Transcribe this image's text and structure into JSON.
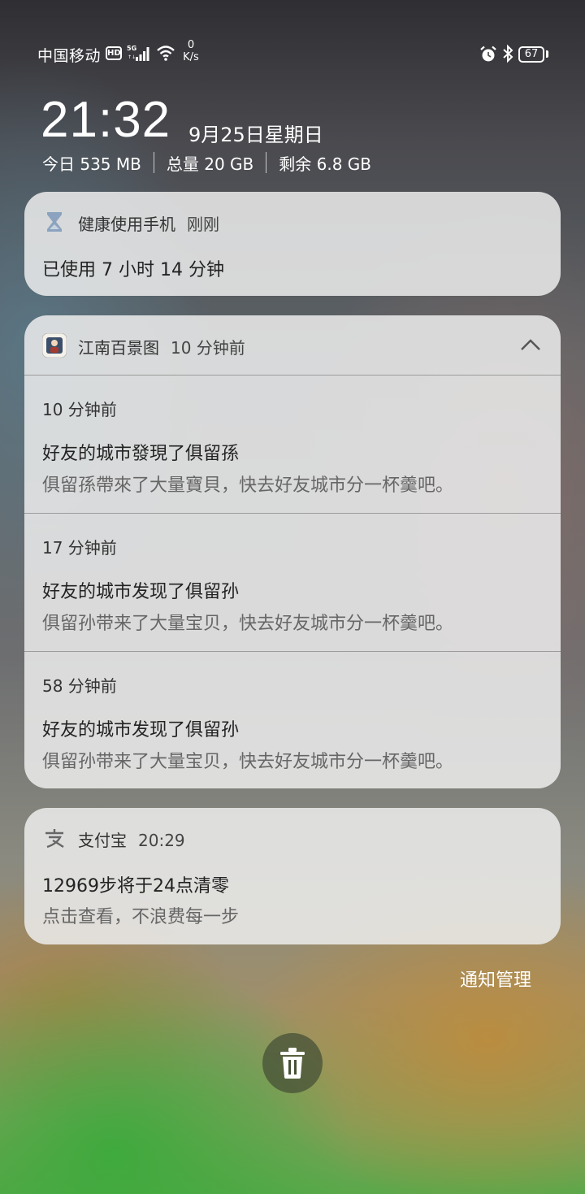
{
  "status_bar": {
    "carrier": "中国移动",
    "hd": "HD",
    "net_speed_value": "0",
    "net_speed_unit": "K/s",
    "battery": "67",
    "icons": [
      "signal-5g-icon",
      "wifi-icon",
      "alarm-icon",
      "bluetooth-icon",
      "battery-icon"
    ]
  },
  "lockscreen": {
    "time": "21:32",
    "date": "9月25日星期日",
    "memory": {
      "today": "今日 535 MB",
      "total": "总量 20 GB",
      "remaining": "剩余 6.8 GB"
    }
  },
  "notifications": [
    {
      "app": "健康使用手机",
      "time": "刚刚",
      "icon": "hourglass-icon",
      "title": "已使用 7 小时 14 分钟"
    },
    {
      "app": "江南百景图",
      "time": "10 分钟前",
      "icon": "game-app-icon",
      "expanded": true,
      "items": [
        {
          "time": "10 分钟前",
          "title": "好友的城市發現了俱留孫",
          "body": "俱留孫帶來了大量寶貝，快去好友城市分一杯羹吧。"
        },
        {
          "time": "17 分钟前",
          "title": "好友的城市发现了俱留孙",
          "body": "俱留孙带来了大量宝贝，快去好友城市分一杯羹吧。"
        },
        {
          "time": "58 分钟前",
          "title": "好友的城市发现了俱留孙",
          "body": "俱留孙带来了大量宝贝，快去好友城市分一杯羹吧。"
        }
      ]
    },
    {
      "app": "支付宝",
      "time": "20:29",
      "icon": "alipay-icon",
      "title": "12969步将于24点清零",
      "body": "点击查看，不浪费每一步"
    }
  ],
  "actions": {
    "manage_label": "通知管理",
    "clear_icon": "trash-icon"
  },
  "colors": {
    "card_bg": "#ececec",
    "text_primary": "#222222",
    "text_secondary": "#666666",
    "clear_button": "#465037"
  }
}
